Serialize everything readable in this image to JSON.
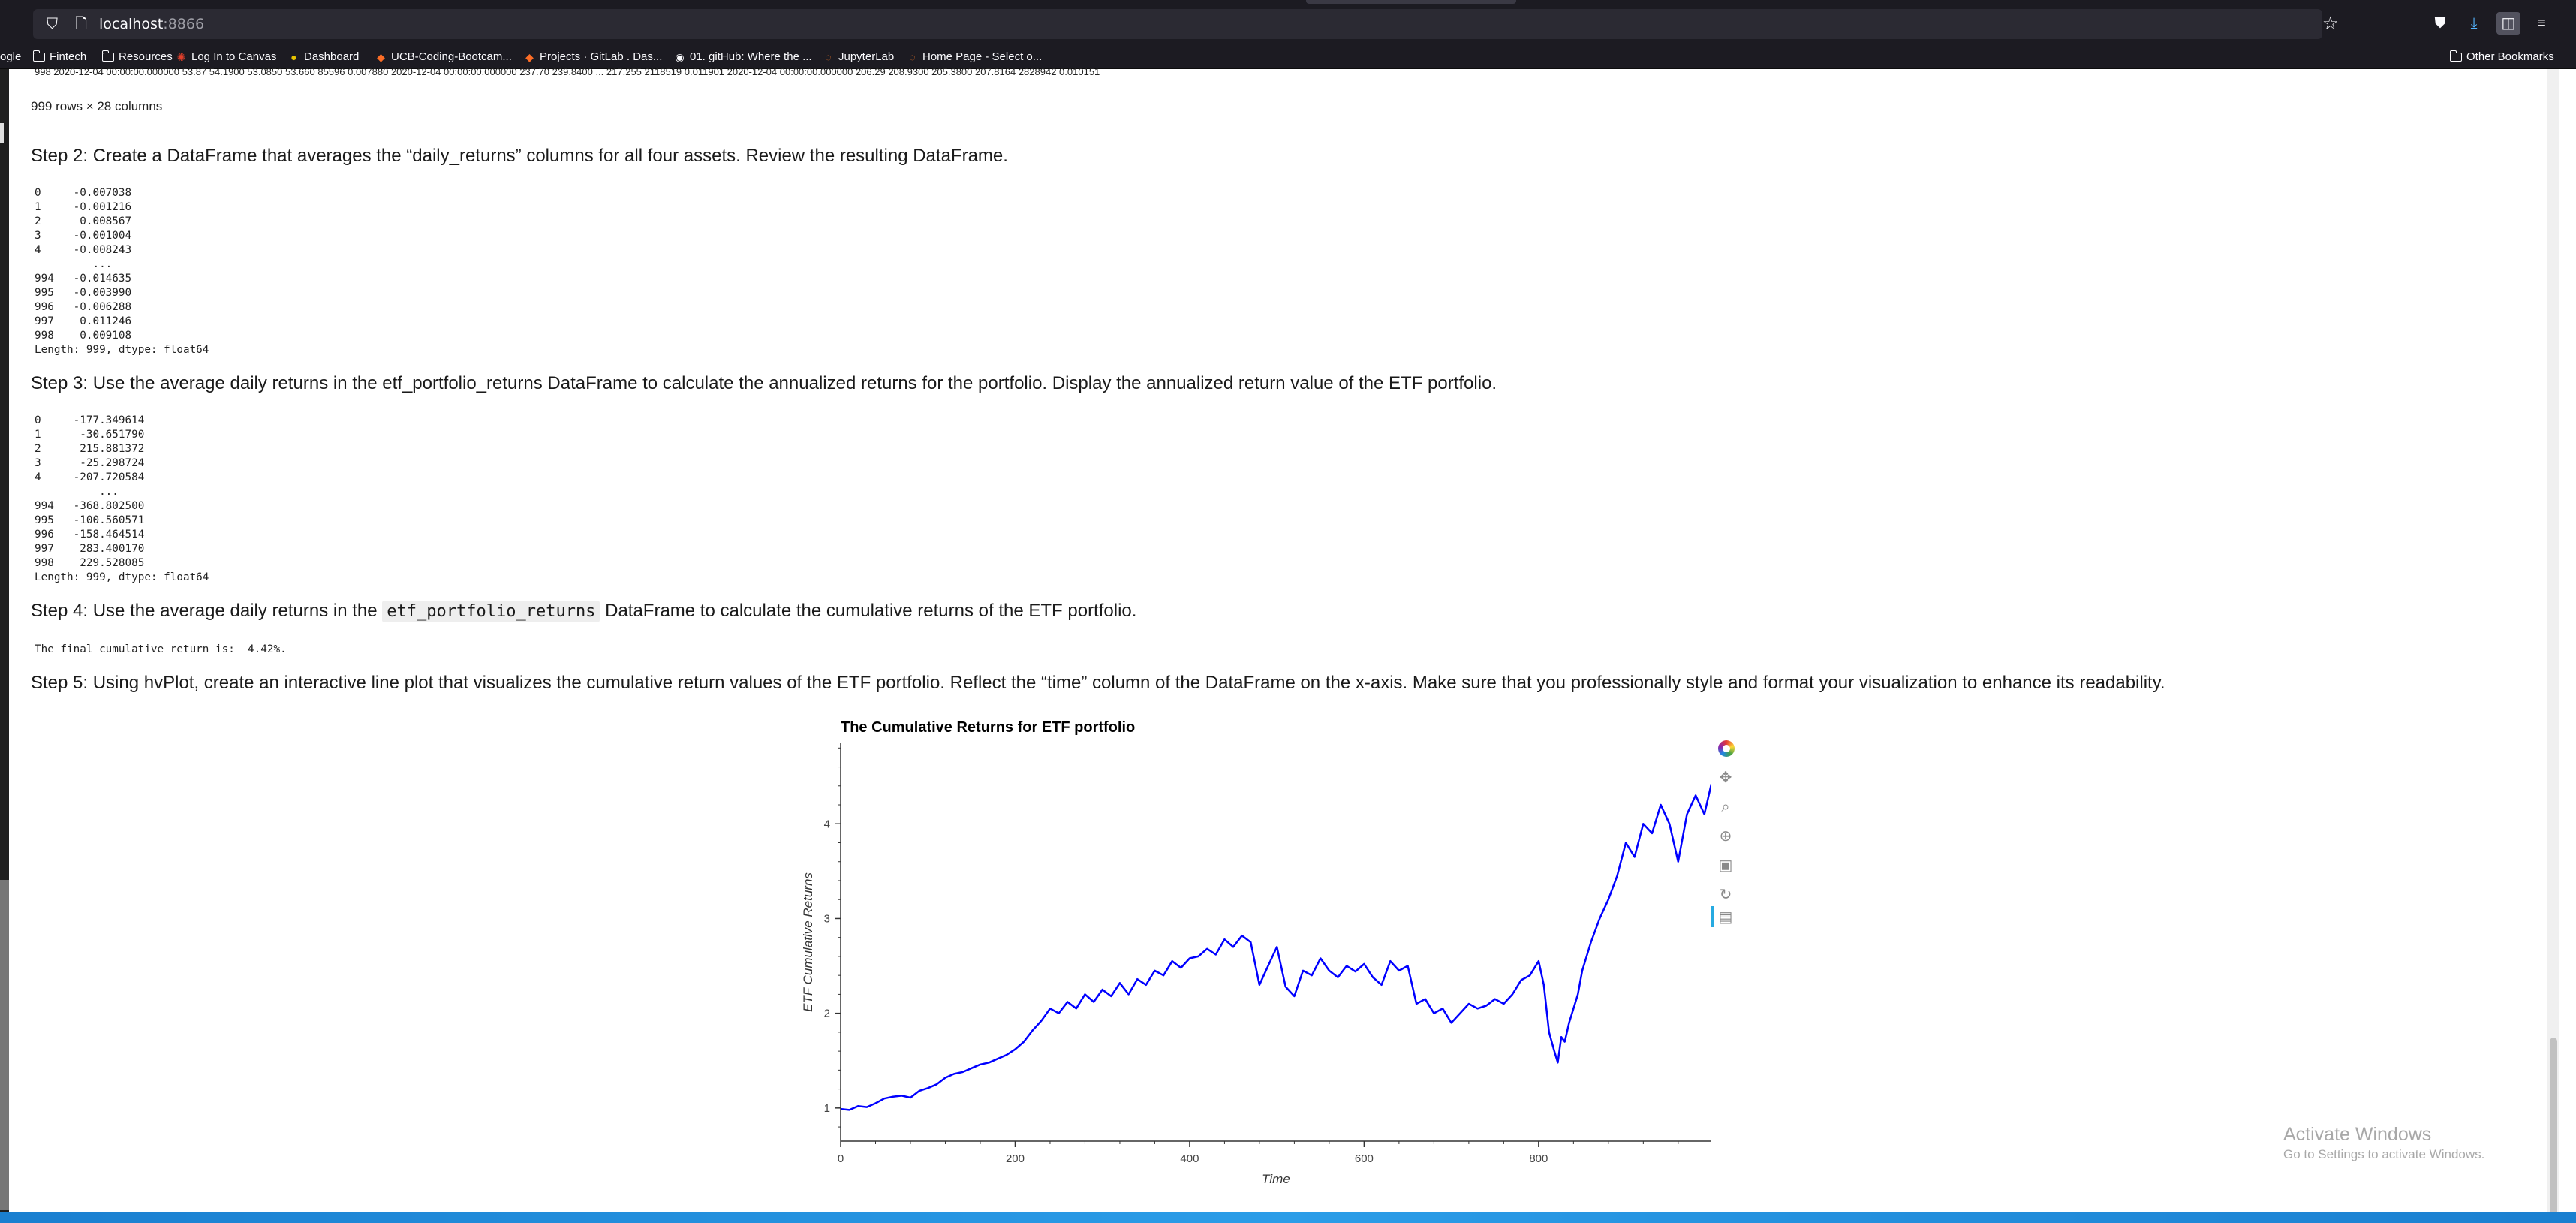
{
  "browser": {
    "url_host": "localhost",
    "url_port": ":8866",
    "bookmarks": [
      {
        "label": "ogle",
        "icon": "none"
      },
      {
        "label": "Fintech",
        "icon": "folder-icon"
      },
      {
        "label": "Resources",
        "icon": "folder-icon"
      },
      {
        "label": "Log In to Canvas",
        "icon": "canvas-icon"
      },
      {
        "label": "Dashboard",
        "icon": "dashboard-icon"
      },
      {
        "label": "UCB-Coding-Bootcam...",
        "icon": "gitlab-icon"
      },
      {
        "label": "Projects · GitLab . Das...",
        "icon": "gitlab-icon"
      },
      {
        "label": "01. gitHub: Where the ...",
        "icon": "github-icon"
      },
      {
        "label": "JupyterLab",
        "icon": "jupyter-icon"
      },
      {
        "label": "Home Page - Select o...",
        "icon": "jupyter-icon"
      }
    ],
    "other_bookmarks": "Other Bookmarks"
  },
  "notebook": {
    "cut_row": "998   2020-12-04 00:00:00.000000   53.87   54.1900   53.0850   53.660    85596          0.007880   2020-12-04 00:00:00.000000   237.70   239.8400   ...   217.255   2118519          0.011901   2020-12-04 00:00:00.000000   206.29   208.9300   205.3800   207.8164   2828942          0.010151",
    "shape": "999 rows × 28 columns",
    "step2": "Step 2: Create a DataFrame that averages the “daily_returns” columns for all four assets. Review the resulting DataFrame.",
    "out2": "0     -0.007038\n1     -0.001216\n2      0.008567\n3     -0.001004\n4     -0.008243\n         ...\n994   -0.014635\n995   -0.003990\n996   -0.006288\n997    0.011246\n998    0.009108\nLength: 999, dtype: float64",
    "step3": "Step 3: Use the average daily returns in the etf_portfolio_returns DataFrame to calculate the annualized returns for the portfolio. Display the annualized return value of the ETF portfolio.",
    "out3": "0     -177.349614\n1      -30.651790\n2      215.881372\n3      -25.298724\n4     -207.720584\n          ...\n994   -368.802500\n995   -100.560571\n996   -158.464514\n997    283.400170\n998    229.528085\nLength: 999, dtype: float64",
    "step4_pre": "Step 4: Use the average daily returns in the ",
    "step4_code": "etf_portfolio_returns",
    "step4_post": " DataFrame to calculate the cumulative returns of the ETF portfolio.",
    "out4": "The final cumulative return is:  4.42%.",
    "step5": "Step 5: Using hvPlot, create an interactive line plot that visualizes the cumulative return values of the ETF portfolio. Reflect the “time” column of the DataFrame on the x-axis. Make sure that you professionally style and format your visualization to enhance its readability."
  },
  "chart_data": {
    "type": "line",
    "title": "The Cumulative Returns for ETF portfolio",
    "xlabel": "Time",
    "ylabel": "ETF Cumulative Returns",
    "xlim": [
      0,
      998
    ],
    "ylim": [
      0.65,
      4.85
    ],
    "xticks": [
      0,
      200,
      400,
      600,
      800
    ],
    "yticks": [
      1,
      2,
      3,
      4
    ],
    "line_color": "#0000ff",
    "grid": false,
    "series": [
      {
        "x": [
          0,
          10,
          20,
          30,
          40,
          50,
          60,
          70,
          80,
          90,
          100,
          110,
          120,
          130,
          140,
          150,
          160,
          170,
          180,
          190,
          200,
          210,
          220,
          230,
          240,
          250,
          260,
          270,
          280,
          290,
          300,
          310,
          320,
          330,
          340,
          350,
          360,
          370,
          380,
          390,
          400,
          410,
          420,
          430,
          440,
          450,
          460,
          470,
          480,
          490,
          500,
          510,
          520,
          530,
          540,
          550,
          560,
          570,
          580,
          590,
          600,
          610,
          620,
          630,
          640,
          650,
          660,
          670,
          680,
          690,
          700,
          710,
          720,
          730,
          740,
          750,
          760,
          770,
          780,
          790,
          800,
          806,
          812,
          818,
          822,
          826,
          830,
          835,
          840,
          845,
          850,
          860,
          870,
          880,
          890,
          900,
          910,
          920,
          930,
          940,
          950,
          960,
          970,
          980,
          990,
          998
        ],
        "y": [
          0.99,
          0.98,
          1.02,
          1.01,
          1.05,
          1.1,
          1.12,
          1.13,
          1.11,
          1.18,
          1.21,
          1.25,
          1.32,
          1.36,
          1.38,
          1.42,
          1.46,
          1.48,
          1.52,
          1.56,
          1.62,
          1.7,
          1.82,
          1.92,
          2.05,
          2.0,
          2.12,
          2.05,
          2.2,
          2.12,
          2.25,
          2.18,
          2.32,
          2.2,
          2.36,
          2.3,
          2.45,
          2.4,
          2.55,
          2.48,
          2.58,
          2.6,
          2.68,
          2.62,
          2.78,
          2.7,
          2.82,
          2.75,
          2.3,
          2.5,
          2.7,
          2.28,
          2.18,
          2.45,
          2.4,
          2.58,
          2.45,
          2.38,
          2.5,
          2.44,
          2.52,
          2.38,
          2.3,
          2.55,
          2.45,
          2.5,
          2.1,
          2.15,
          2.0,
          2.05,
          1.9,
          2.0,
          2.1,
          2.05,
          2.08,
          2.15,
          2.1,
          2.2,
          2.35,
          2.4,
          2.55,
          2.3,
          1.8,
          1.6,
          1.48,
          1.75,
          1.7,
          1.9,
          2.05,
          2.2,
          2.45,
          2.75,
          3.0,
          3.2,
          3.45,
          3.8,
          3.65,
          4.0,
          3.9,
          4.2,
          4.0,
          3.6,
          4.1,
          4.3,
          4.1,
          4.42
        ]
      }
    ]
  },
  "page": {
    "activate_title": "Activate Windows",
    "activate_sub": "Go to Settings to activate Windows."
  }
}
